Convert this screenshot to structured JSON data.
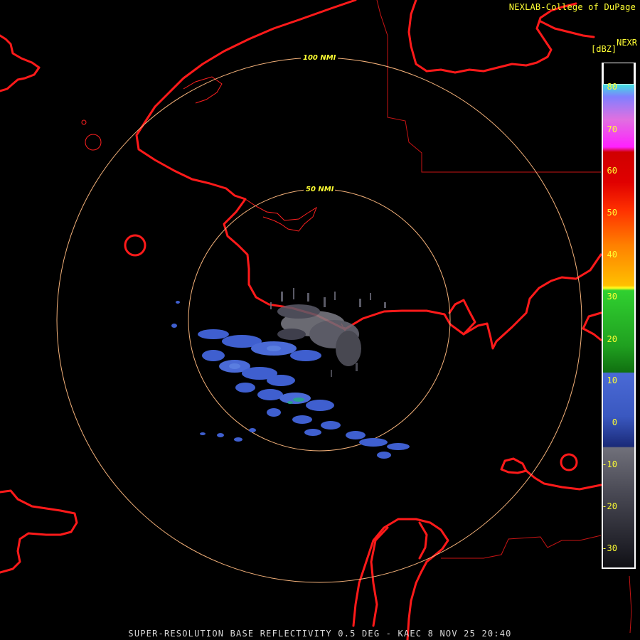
{
  "header": {
    "credit": "NEXLAB-College of DuPage",
    "product_code": "NEXR"
  },
  "range_rings": [
    {
      "label": "50 NMI",
      "radius_nmi": 50
    },
    {
      "label": "100 NMI",
      "radius_nmi": 100
    }
  ],
  "legend": {
    "units": "[dBZ]",
    "ticks": [
      "80",
      "70",
      "60",
      "50",
      "40",
      "30",
      "20",
      "10",
      "0",
      "-10",
      "-20",
      "-30"
    ],
    "scale_min": -35,
    "scale_max": 85,
    "colors": {
      "-35": "#6a6a72",
      "-20": "#3a3a40",
      "-11": "#28283a",
      "-10": "#1a2a78",
      "5": "#4466d0",
      "10": "#2a9f2a",
      "20": "#20c030",
      "30": "#ffff20",
      "40": "#ff9a00",
      "50": "#ff2000",
      "60": "#d00000",
      "68": "#ff40ff",
      "76": "#8080ff",
      "80": "#40e0e0"
    }
  },
  "map": {
    "radar_site": "KAEC",
    "boundary_color": "#ff1a1a",
    "ring_color": "#f5b27a"
  },
  "footer": {
    "caption": "SUPER-RESOLUTION BASE REFLECTIVITY 0.5 DEG - KAEC 8 NOV 25 20:40"
  }
}
